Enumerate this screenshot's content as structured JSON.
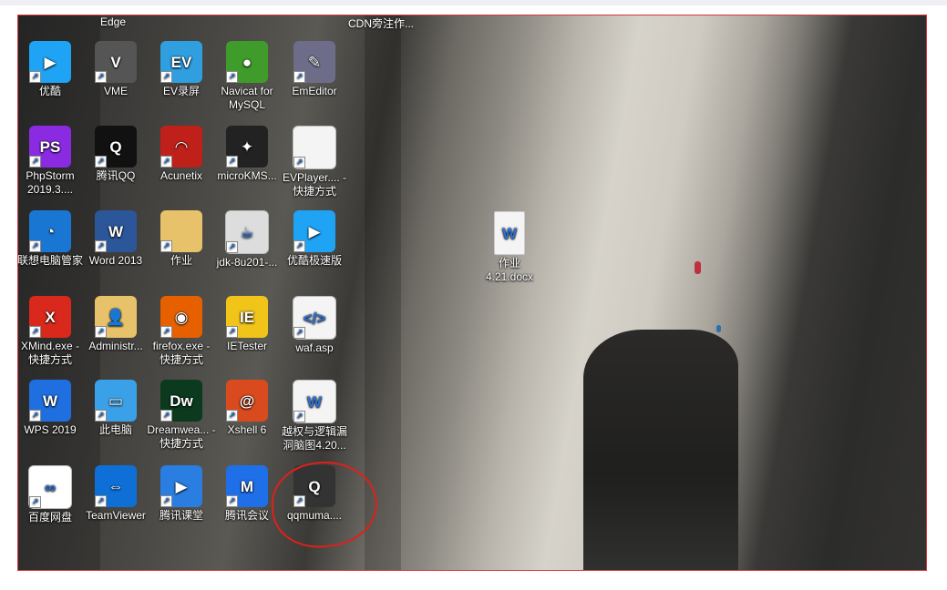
{
  "top_labels": [
    "Edge",
    "CDN旁注作..."
  ],
  "icons": [
    {
      "label": "优酷",
      "icon": "youku-icon",
      "color": "#1fa3f5"
    },
    {
      "label": "VME",
      "icon": "vme-icon",
      "color": "#555"
    },
    {
      "label": "EV录屏",
      "icon": "ev-recorder-icon",
      "color": "#2f9fe0"
    },
    {
      "label": "Navicat for MySQL",
      "icon": "navicat-icon",
      "color": "#3f9b2a"
    },
    {
      "label": "EmEditor",
      "icon": "emeditor-icon",
      "color": "#6d6d8a"
    },
    {
      "label": "PhpStorm 2019.3....",
      "icon": "phpstorm-icon",
      "color": "#8a2be2"
    },
    {
      "label": "腾讯QQ",
      "icon": "qq-icon",
      "color": "#111"
    },
    {
      "label": "Acunetix",
      "icon": "acunetix-icon",
      "color": "#c0201a"
    },
    {
      "label": "microKMS...",
      "icon": "microkms-icon",
      "color": "#222"
    },
    {
      "label": "EVPlayer.... - 快捷方式",
      "icon": "file-icon",
      "color": "#f4f4f4"
    },
    {
      "label": "联想电脑管家",
      "icon": "lenovo-pc-manager-icon",
      "color": "#1976d2"
    },
    {
      "label": "Word 2013",
      "icon": "word-icon",
      "color": "#2b579a"
    },
    {
      "label": "作业",
      "icon": "folder-icon",
      "color": "#e8c26a"
    },
    {
      "label": "jdk-8u201-...",
      "icon": "java-icon",
      "color": "#ddd"
    },
    {
      "label": "优酷极速版",
      "icon": "youku-lite-icon",
      "color": "#1fa3f5"
    },
    {
      "label": "XMind.exe - 快捷方式",
      "icon": "xmind-icon",
      "color": "#d9281c"
    },
    {
      "label": "Administr...",
      "icon": "user-folder-icon",
      "color": "#e8c26a"
    },
    {
      "label": "firefox.exe - 快捷方式",
      "icon": "firefox-icon",
      "color": "#e66000"
    },
    {
      "label": "IETester",
      "icon": "ietester-icon",
      "color": "#f0c419"
    },
    {
      "label": "waf.asp",
      "icon": "asp-file-icon",
      "color": "#f4f4f4"
    },
    {
      "label": "WPS 2019",
      "icon": "wps-icon",
      "color": "#1f6fe0"
    },
    {
      "label": "此电脑",
      "icon": "this-pc-icon",
      "color": "#3aa0e8"
    },
    {
      "label": "Dreamwea... - 快捷方式",
      "icon": "dreamweaver-icon",
      "color": "#0b3a1e"
    },
    {
      "label": "Xshell 6",
      "icon": "xshell-icon",
      "color": "#d94a1e"
    },
    {
      "label": "越权与逻辑漏洞脑图4.20...",
      "icon": "wps-doc-icon",
      "color": "#f4f4f4"
    },
    {
      "label": "百度网盘",
      "icon": "baidu-netdisk-icon",
      "color": "#fff"
    },
    {
      "label": "TeamViewer",
      "icon": "teamviewer-icon",
      "color": "#0e6fd6"
    },
    {
      "label": "腾讯课堂",
      "icon": "tencent-classroom-icon",
      "color": "#2a7de1"
    },
    {
      "label": "腾讯会议",
      "icon": "tencent-meeting-icon",
      "color": "#1f6fe8"
    },
    {
      "label": "qqmuma....",
      "icon": "qq-shield-icon",
      "color": "#333"
    }
  ],
  "file_on_desktop": {
    "label": "作业 4.21.docx",
    "icon": "wps-doc-icon"
  }
}
